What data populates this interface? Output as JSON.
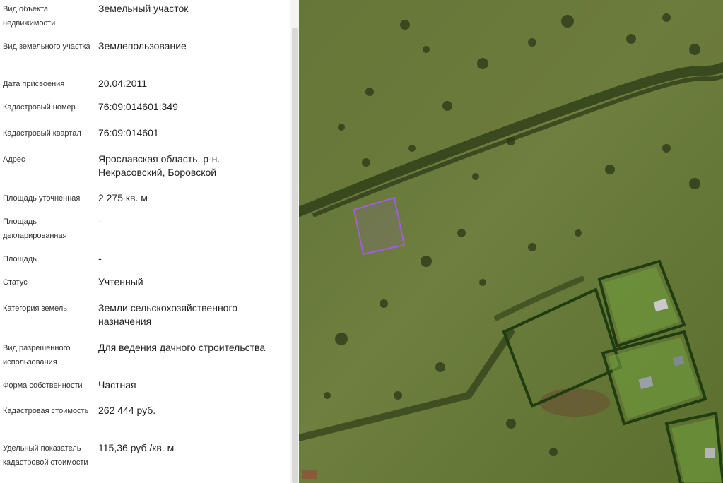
{
  "rows": [
    {
      "label": "Вид объекта недвижимости",
      "value": "Земельный участок"
    },
    {
      "label": "Вид земельного участка",
      "value": "Землепользование"
    },
    {
      "label": "Дата присвоения",
      "value": "20.04.2011"
    },
    {
      "label": "Кадастровый номер",
      "value": "76:09:014601:349"
    },
    {
      "label": "Кадастровый квартал",
      "value": "76:09:014601"
    },
    {
      "label": "Адрес",
      "value": "Ярославская область, р-н. Некрасовский, Боровской"
    },
    {
      "label": "Площадь уточненная",
      "value": "2 275 кв. м"
    },
    {
      "label": "Площадь декларированная",
      "value": "-"
    },
    {
      "label": "Площадь",
      "value": "-"
    },
    {
      "label": "Статус",
      "value": "Учтенный"
    },
    {
      "label": "Категория земель",
      "value": "Земли сельскохозяйственного назначения"
    },
    {
      "label": "Вид разрешенного использования",
      "value": "Для ведения дачного строительства"
    },
    {
      "label": "Форма собственности",
      "value": "Частная"
    },
    {
      "label": "Кадастровая стоимость",
      "value": "262 444 руб."
    },
    {
      "label": "Удельный показатель кадастровой стоимости",
      "value": "115,36 руб./кв. м"
    }
  ],
  "map": {
    "layer": "satellite-imagery",
    "parcel_outline_color": "#a45be0",
    "fence_color": "#1f3d10"
  }
}
